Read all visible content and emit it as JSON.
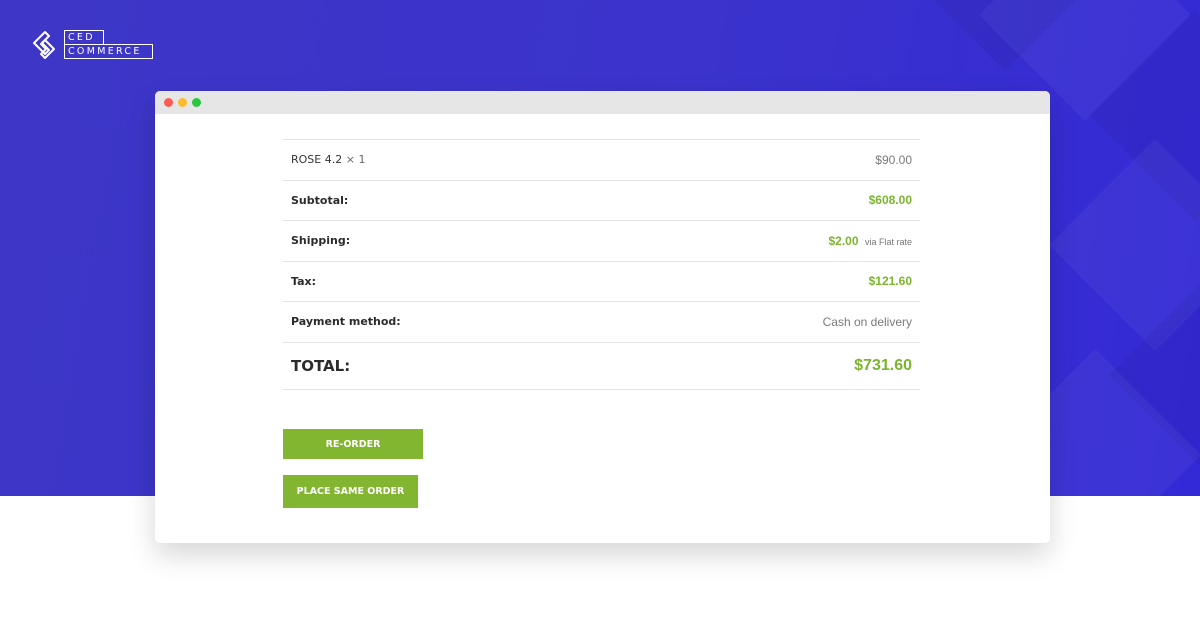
{
  "brand": {
    "logo_line1": "CED",
    "logo_line2": "COMMERCE"
  },
  "window": {
    "buttons": [
      "close",
      "minimize",
      "maximize"
    ]
  },
  "order": {
    "item": {
      "name": "ROSE 4.2",
      "qty": "× 1",
      "price": "$90.00"
    },
    "subtotal": {
      "label": "Subtotal:",
      "value": "$608.00"
    },
    "shipping": {
      "label": "Shipping:",
      "value": "$2.00",
      "method": "via Flat rate"
    },
    "tax": {
      "label": "Tax:",
      "value": "$121.60"
    },
    "payment": {
      "label": "Payment method:",
      "value": "Cash on delivery"
    },
    "total": {
      "label": "TOTAL:",
      "value": "$731.60"
    }
  },
  "actions": {
    "reorder_label": "RE-ORDER",
    "place_same_label": "PLACE SAME ORDER"
  },
  "colors": {
    "background": "#3b33cc",
    "accent_green": "#82b530",
    "price_green": "#7bb52d"
  }
}
